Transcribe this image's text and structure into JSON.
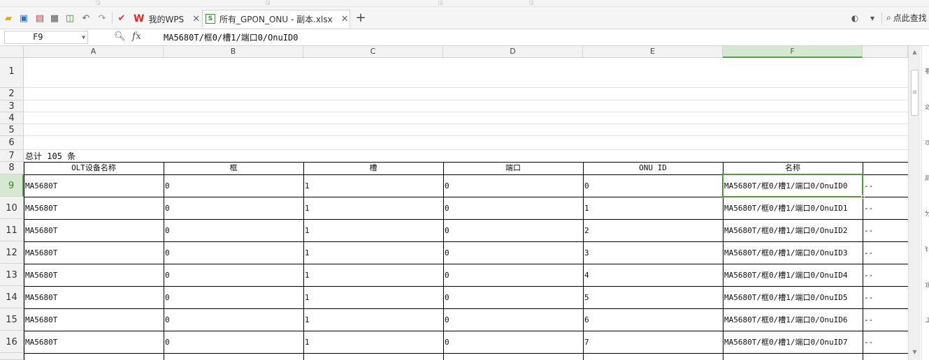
{
  "tabs": [
    {
      "label": "我的WPS",
      "active": false
    },
    {
      "label": "所有_GPON_ONU - 副本.xlsx",
      "active": true
    }
  ],
  "search_hint": "点此查找",
  "name_box": "F9",
  "formula_value": "MA5680T/框0/槽1/端口0/OnuID0",
  "columns": [
    "A",
    "B",
    "C",
    "D",
    "E",
    "F"
  ],
  "selected_column": "F",
  "selected_row": "9",
  "summary": "总计 105 条",
  "table_headers": [
    "OLT设备名称",
    "框",
    "槽",
    "端口",
    "ONU ID",
    "名称"
  ],
  "rows": [
    {
      "row": "9",
      "cells": [
        "MA5680T",
        "0",
        "1",
        "0",
        "0",
        "MA5680T/框0/槽1/端口0/OnuID0",
        "--"
      ]
    },
    {
      "row": "10",
      "cells": [
        "MA5680T",
        "0",
        "1",
        "0",
        "1",
        "MA5680T/框0/槽1/端口0/OnuID1",
        "--"
      ]
    },
    {
      "row": "11",
      "cells": [
        "MA5680T",
        "0",
        "1",
        "0",
        "2",
        "MA5680T/框0/槽1/端口0/OnuID2",
        "--"
      ]
    },
    {
      "row": "12",
      "cells": [
        "MA5680T",
        "0",
        "1",
        "0",
        "3",
        "MA5680T/框0/槽1/端口0/OnuID3",
        "--"
      ]
    },
    {
      "row": "13",
      "cells": [
        "MA5680T",
        "0",
        "1",
        "0",
        "4",
        "MA5680T/框0/槽1/端口0/OnuID4",
        "--"
      ]
    },
    {
      "row": "14",
      "cells": [
        "MA5680T",
        "0",
        "1",
        "0",
        "5",
        "MA5680T/框0/槽1/端口0/OnuID5",
        "--"
      ]
    },
    {
      "row": "15",
      "cells": [
        "MA5680T",
        "0",
        "1",
        "0",
        "6",
        "MA5680T/框0/槽1/端口0/OnuID6",
        "--"
      ]
    },
    {
      "row": "16",
      "cells": [
        "MA5680T",
        "0",
        "1",
        "0",
        "7",
        "MA5680T/框0/槽1/端口0/OnuID7",
        "--"
      ]
    }
  ],
  "header_rows": [
    "1",
    "2",
    "3",
    "4",
    "5",
    "6",
    "7",
    "8"
  ],
  "right_pane_glyphs": [
    "看",
    "选",
    "示",
    "启",
    "分",
    "钉",
    "设",
    "工"
  ],
  "colors": {
    "accent": "#5a9e47",
    "selection_fill": "#d7e8d2",
    "wps_red": "#e02a2a"
  }
}
